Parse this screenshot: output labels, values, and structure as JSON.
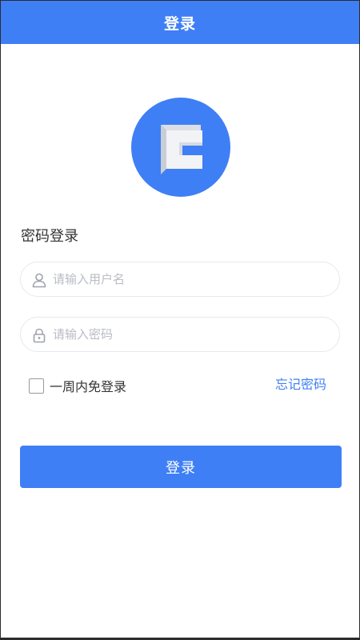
{
  "header": {
    "title": "登录"
  },
  "login": {
    "section_title": "密码登录",
    "username": {
      "placeholder": "请输入用户名",
      "value": ""
    },
    "password": {
      "placeholder": "请输入密码",
      "value": ""
    },
    "remember_label": "一周内免登录",
    "remember_checked": false,
    "forgot_label": "忘记密码",
    "submit_label": "登录"
  },
  "icons": {
    "logo": "app-logo-c",
    "username": "user-icon",
    "password": "lock-icon"
  },
  "colors": {
    "primary": "#3f7ff5",
    "border": "#e6e8ee",
    "placeholder": "#b9bcc4",
    "text": "#333333"
  }
}
